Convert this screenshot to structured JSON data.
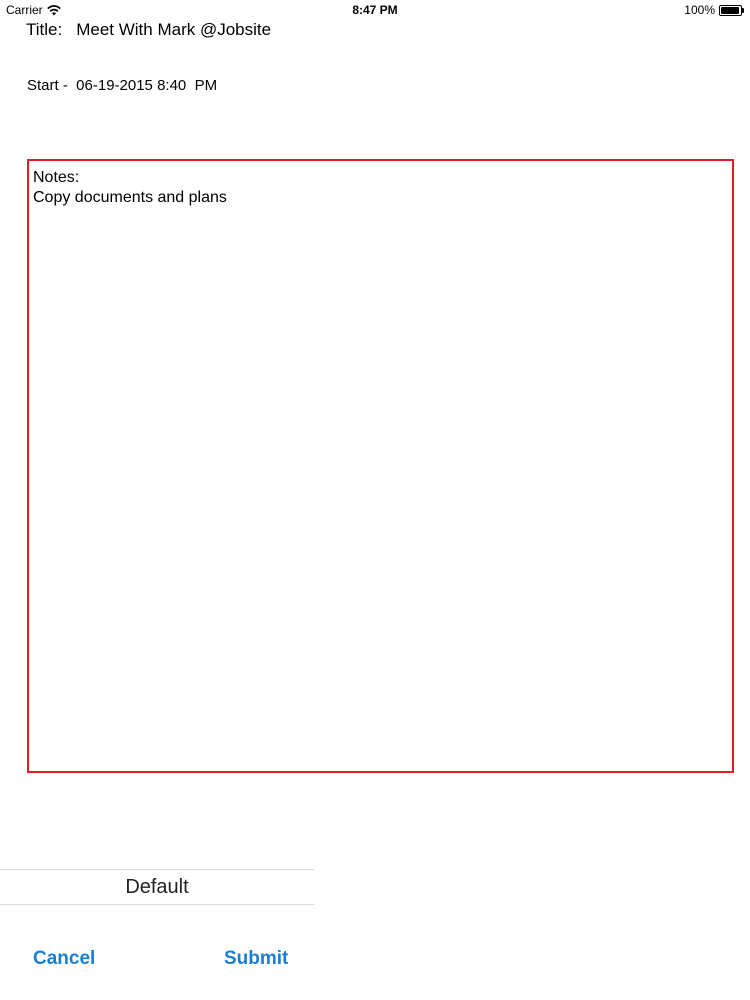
{
  "status_bar": {
    "carrier": "Carrier",
    "time": "8:47 PM",
    "battery_percent": "100%",
    "battery_level": 1.0,
    "icons": [
      "wifi-icon",
      "battery-icon"
    ]
  },
  "event": {
    "title_label": "Title:",
    "title_value": "Meet With Mark @Jobsite",
    "start_text": "Start -  06-19-2015 8:40  PM"
  },
  "notes": {
    "label": "Notes:",
    "text": "Copy documents and plans",
    "border_color": "#e51c23"
  },
  "picker": {
    "selected": "Default"
  },
  "actions": {
    "cancel_label": "Cancel",
    "submit_label": "Submit",
    "accent_color": "#1a7fd1"
  }
}
